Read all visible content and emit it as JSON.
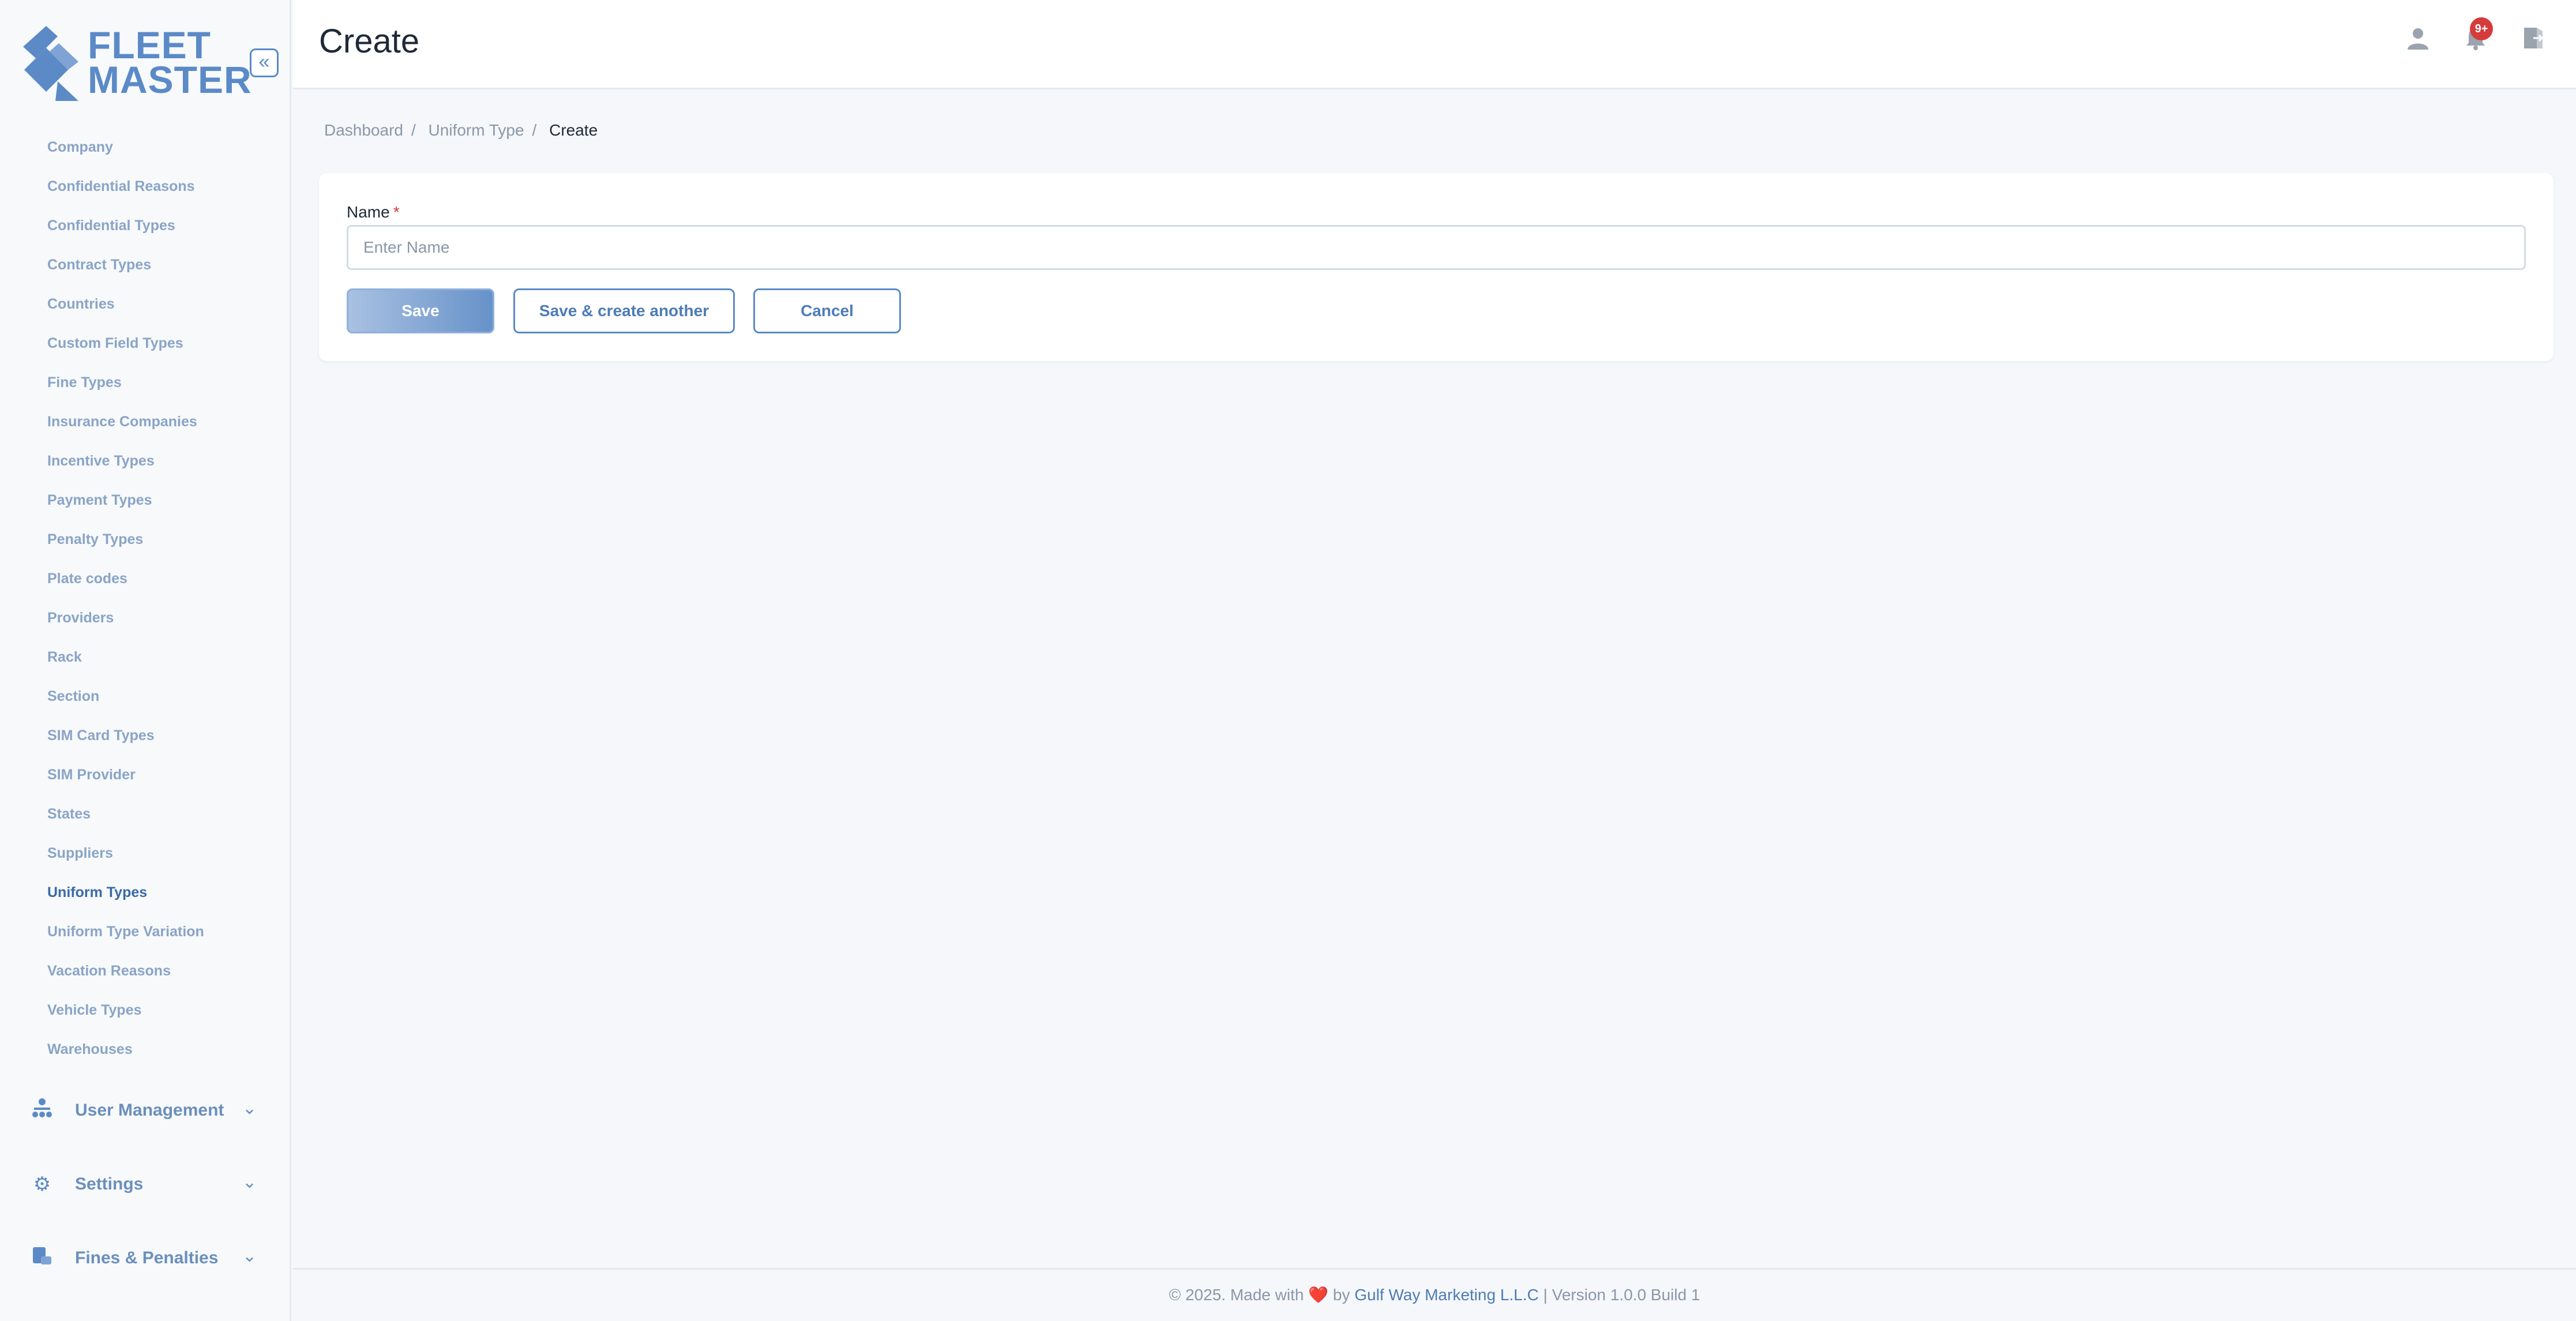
{
  "brand": {
    "line1": "FLEET",
    "line2": "MASTER",
    "color": "#5b8ac7"
  },
  "sidebar": {
    "collapse_icon": "«",
    "items": [
      {
        "label": "Company"
      },
      {
        "label": "Confidential Reasons"
      },
      {
        "label": "Confidential Types"
      },
      {
        "label": "Contract Types"
      },
      {
        "label": "Countries"
      },
      {
        "label": "Custom Field Types"
      },
      {
        "label": "Fine Types"
      },
      {
        "label": "Insurance Companies"
      },
      {
        "label": "Incentive Types"
      },
      {
        "label": "Payment Types"
      },
      {
        "label": "Penalty Types"
      },
      {
        "label": "Plate codes"
      },
      {
        "label": "Providers"
      },
      {
        "label": "Rack"
      },
      {
        "label": "Section"
      },
      {
        "label": "SIM Card Types"
      },
      {
        "label": "SIM Provider"
      },
      {
        "label": "States"
      },
      {
        "label": "Suppliers"
      },
      {
        "label": "Uniform Types",
        "active": true
      },
      {
        "label": "Uniform Type Variation"
      },
      {
        "label": "Vacation Reasons"
      },
      {
        "label": "Vehicle Types"
      },
      {
        "label": "Warehouses"
      }
    ],
    "groups": [
      {
        "label": "User Management",
        "icon": "users-tree-icon"
      },
      {
        "label": "Settings",
        "icon": "gear-icon"
      },
      {
        "label": "Fines & Penalties",
        "icon": "fines-icon"
      }
    ]
  },
  "header": {
    "title": "Create",
    "notification_badge": "9+"
  },
  "breadcrumb": [
    "Dashboard",
    "Uniform Type",
    "Create"
  ],
  "form": {
    "name_label": "Name",
    "required_mark": "*",
    "name_placeholder": "Enter Name",
    "name_value": "",
    "save_label": "Save",
    "save_another_label": "Save & create another",
    "cancel_label": "Cancel"
  },
  "footer": {
    "prefix": "© 2025. Made with",
    "heart": "❤️",
    "by": "by",
    "company": "Gulf Way Marketing L.L.C",
    "suffix": "| Version 1.0.0 Build 1"
  }
}
